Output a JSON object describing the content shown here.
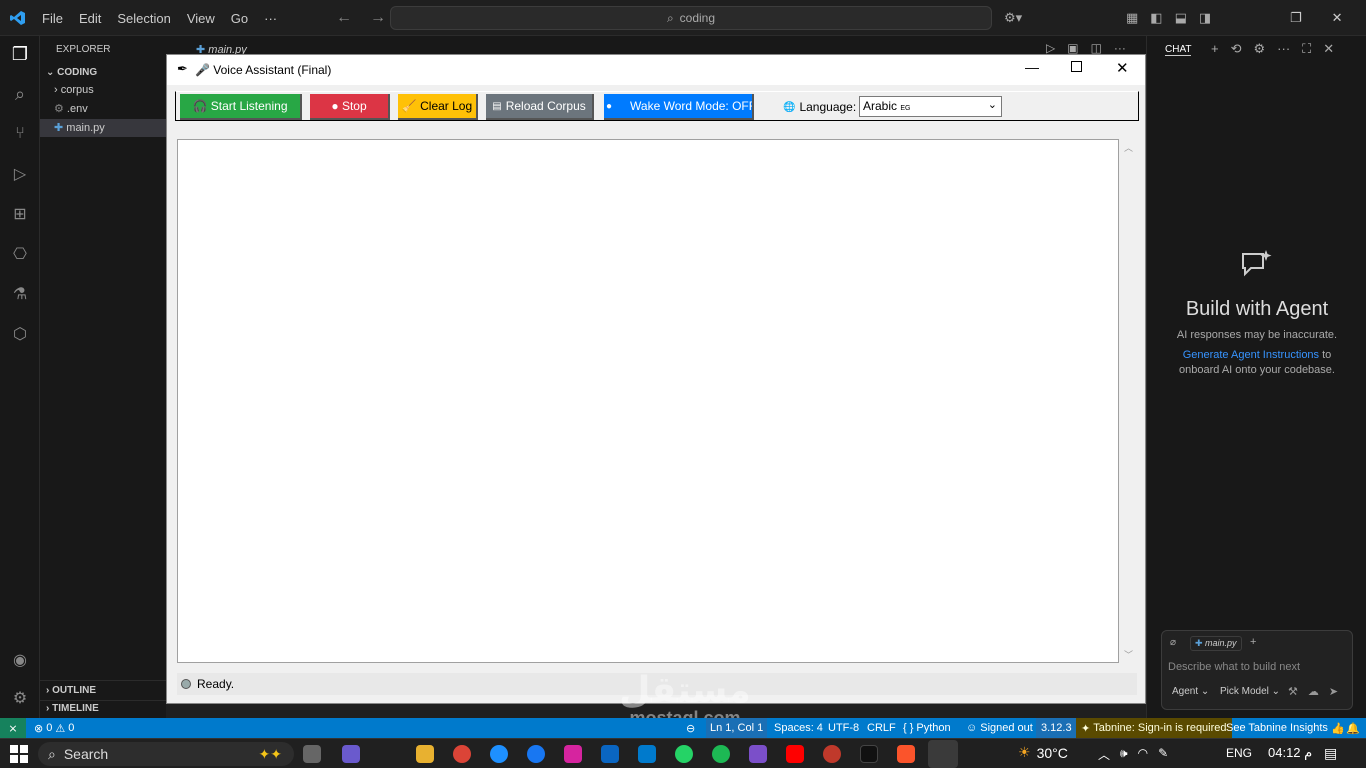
{
  "vscode": {
    "menu": [
      "File",
      "Edit",
      "Selection",
      "View",
      "Go"
    ],
    "more": "···",
    "search_text": "coding",
    "explorer_title": "EXPLORER",
    "folder": "CODING",
    "files": [
      "corpus",
      ".env",
      "main.py"
    ],
    "tab_name": "main.py",
    "outline": "OUTLINE",
    "timeline": "TIMELINE",
    "chat_tab": "CHAT"
  },
  "chat": {
    "title": "Build with Agent",
    "disclaimer": "AI responses may be inaccurate.",
    "link": "Generate Agent Instructions",
    "link_tail": " to",
    "line2": "onboard AI onto your codebase.",
    "attachment": "main.py",
    "placeholder": "Describe what to build next",
    "agent": "Agent",
    "model": "Pick Model"
  },
  "app": {
    "title": "🎤 Voice Assistant (Final)",
    "buttons": {
      "start": "🎧 Start Listening",
      "stop": "● Stop",
      "clear": "🧹 Clear Log",
      "reload": "Reload Corpus",
      "wake": "Wake Word Mode: OFF"
    },
    "language_label": "Language:",
    "language_value": "Arabic",
    "language_suffix": "EG",
    "status": "Ready."
  },
  "statusbar": {
    "errors": "0",
    "warnings": "0",
    "position": "Ln 1, Col 1",
    "spaces": "Spaces: 4",
    "encoding": "UTF-8",
    "eol": "CRLF",
    "language": "Python",
    "account": "Signed out",
    "python_version": "3.12.3",
    "tabnine": "Tabnine: Sign-in is required",
    "tabnine_insights": "See Tabnine Insights"
  },
  "taskbar": {
    "search": "Search",
    "temperature": "30°C",
    "lang": "ENG",
    "time": "04:12 م"
  },
  "watermark": {
    "line1": "مستقل",
    "line2": "mostaql.com"
  },
  "colors": {
    "start": "#28a745",
    "stop": "#dc3545",
    "clear": "#ffc107",
    "reload": "#6c757d",
    "wake": "#007bff",
    "statusbar": "#007acc"
  }
}
